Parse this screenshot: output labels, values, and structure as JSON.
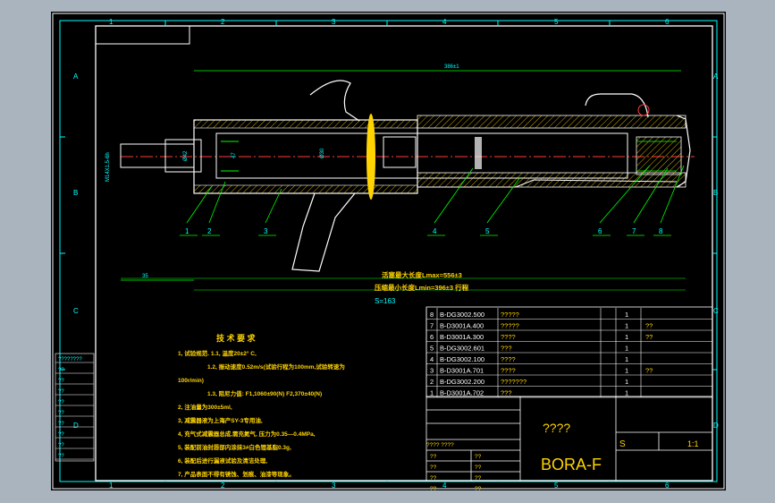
{
  "zone_labels": {
    "cols": [
      "1",
      "2",
      "3",
      "4",
      "5",
      "6"
    ],
    "rows": [
      "A",
      "B",
      "C",
      "D"
    ]
  },
  "dims": {
    "overall": "386±1",
    "piston_rod_dia": "M14X1.5-6h",
    "d1": "Ø42",
    "d2": "47",
    "d3": "Ø30",
    "offset": "35"
  },
  "balloons": [
    "1",
    "2",
    "3",
    "4",
    "5",
    "6",
    "7",
    "8"
  ],
  "length_notes": {
    "max": "活塞最大长度Lmax=556±3",
    "min": "压缩最小长度Lmin=396±3  行程",
    "stroke": "S=163"
  },
  "tech": {
    "title": "技 术 要 求",
    "lines": [
      "1, 试验规范. 1.1, 温度20±2° C,",
      "1.2, 振动速度0.52m/s(试验行程为100mm,试验转速为",
      "100r/min)",
      "1.3, 阻尼力值:   F1,1060±90(N)   F2,370±40(N)",
      "2, 注油量为300±5ml,",
      "3, 减震器液为上海产SY-3专用油,",
      "4, 充气式减震器总成,需充氮气, 压力为0.35—0.4MPa,",
      "5, 装配前油封唇部内涂抹3#白色锂基脂0.3g,",
      "6, 装配后进行漏液试验及清洁处理,",
      "7, 产品表面不得有锈蚀、划痕、油漆等现象。"
    ]
  },
  "bom": [
    {
      "no": "8",
      "code": "B-DG3002.500",
      "name": "?????",
      "qty": "1",
      "mat": ""
    },
    {
      "no": "7",
      "code": "B-D3001A.400",
      "name": "?????",
      "qty": "1",
      "mat": "??"
    },
    {
      "no": "6",
      "code": "B-D3001A.300",
      "name": "????",
      "qty": "1",
      "mat": "??"
    },
    {
      "no": "5",
      "code": "B-DG3002.601",
      "name": "???",
      "qty": "1",
      "mat": ""
    },
    {
      "no": "4",
      "code": "B-DG3002.100",
      "name": "????",
      "qty": "1",
      "mat": ""
    },
    {
      "no": "3",
      "code": "B-D3001A.701",
      "name": "????",
      "qty": "1",
      "mat": "??"
    },
    {
      "no": "2",
      "code": "B-DG3002.200",
      "name": "???????",
      "qty": "1",
      "mat": ""
    },
    {
      "no": "1",
      "code": "B-D3001A.702",
      "name": "???",
      "qty": "1",
      "mat": ""
    }
  ],
  "title_block": {
    "name": "????",
    "code": "BORA-F",
    "stage": "S",
    "scale": "1:1",
    "signs": [
      "??",
      "??",
      "??",
      "??"
    ],
    "mid_label": "???? ????"
  },
  "side_stamp": {
    "rows": [
      "????????",
      "??",
      "??",
      "??",
      "??",
      "??",
      "??",
      "??",
      "??",
      "??"
    ]
  }
}
